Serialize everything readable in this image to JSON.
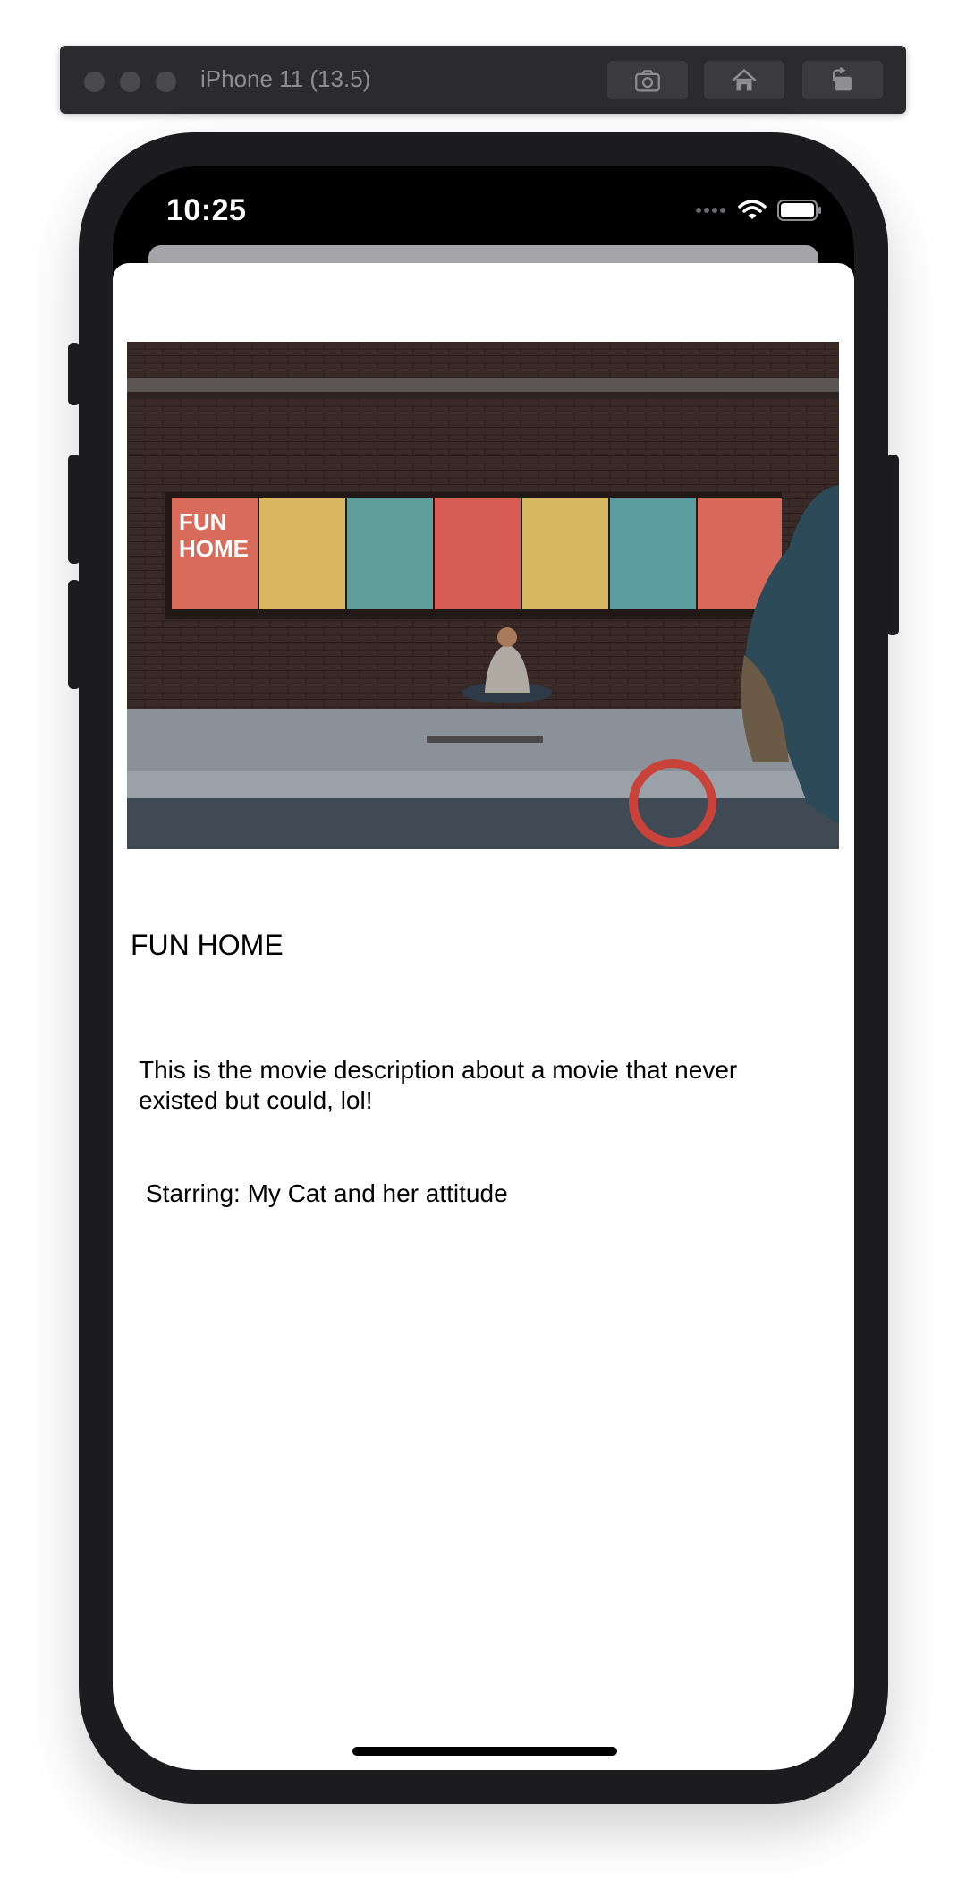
{
  "simulator": {
    "device_title": "iPhone 11 (13.5)",
    "buttons": [
      {
        "icon": "screenshot-camera-icon"
      },
      {
        "icon": "home-icon"
      },
      {
        "icon": "rotate-icon"
      }
    ]
  },
  "status_bar": {
    "time": "10:25",
    "icons": [
      "signal-dots-icon",
      "wifi-icon",
      "battery-icon"
    ]
  },
  "movie": {
    "poster_lettering": [
      "FUN",
      "HOME"
    ],
    "title": "FUN HOME",
    "description": "This is the movie description about a movie that never existed but could, lol!",
    "starring": "Starring: My Cat and her attitude"
  },
  "colors": {
    "sheet_background": "#ffffff",
    "phone_frame": "#1c1c1e",
    "toolbar": "#2b2b2d"
  }
}
